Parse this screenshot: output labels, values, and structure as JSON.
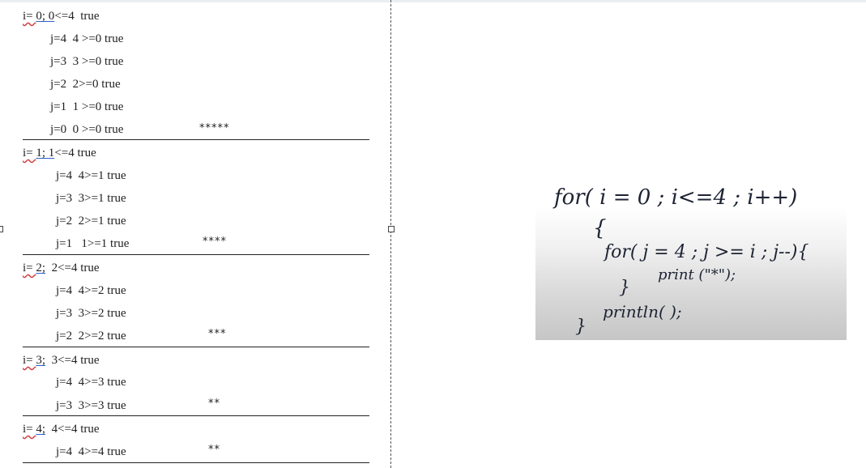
{
  "trace": {
    "outer": [
      {
        "i_prefix": "i= ",
        "i_value": "0; 0",
        "i_rest": "<=4  true",
        "inner": [
          "j=4  4 >=0 true",
          "j=3  3 >=0 true",
          "j=2  2>=0 true",
          "j=1  1 >=0 true",
          "j=0  0 >=0 true"
        ],
        "stars": "*****"
      },
      {
        "i_prefix": "i= ",
        "i_value": "1; 1",
        "i_rest": "<=4 true",
        "inner": [
          "j=4  4>=1 true",
          "j=3  3>=1 true",
          "j=2  2>=1 true",
          "j=1   1>=1 true"
        ],
        "stars": "****"
      },
      {
        "i_prefix": "i= ",
        "i_value": "2;",
        "i_rest": "  2<=4 true",
        "inner": [
          "j=4  4>=2 true",
          "j=3  3>=2 true",
          "j=2  2>=2 true"
        ],
        "stars": "***"
      },
      {
        "i_prefix": "i= ",
        "i_value": "3;",
        "i_rest": "  3<=4 true",
        "inner": [
          "j=4  4>=3 true",
          "j=3  3>=3 true"
        ],
        "stars": "**"
      },
      {
        "i_prefix": "i= ",
        "i_value": "4;",
        "i_rest": "  4<=4 true",
        "inner": [
          "j=4  4>=4 true"
        ],
        "stars": "**"
      }
    ]
  },
  "code_image": {
    "lines": [
      "for( i = 0 ;   i<=4 ;  i++)",
      "{",
      "for( j = 4 ; j >= i ; j--){",
      "print (\"*\");",
      "}",
      "println( );",
      "}"
    ]
  }
}
